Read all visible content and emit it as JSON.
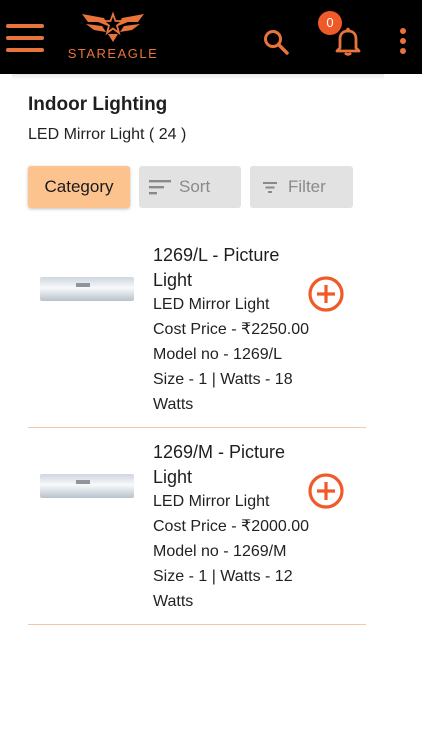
{
  "header": {
    "brand": "STAREAGLE",
    "notification_count": "0",
    "accent_color": "#e8743b",
    "icons": [
      "menu-icon",
      "eagle-logo",
      "search-icon",
      "bell-icon",
      "more-vert-icon"
    ]
  },
  "page": {
    "title": "Indoor Lighting",
    "subtitle": "LED Mirror Light ( 24 )"
  },
  "filters": {
    "category_label": "Category",
    "sort_label": "Sort",
    "filter_label": "Filter"
  },
  "products": [
    {
      "title": "1269/L - Picture Light",
      "category": "LED Mirror Light",
      "cost": "Cost Price - ₹2250.00",
      "model": "Model no - 1269/L",
      "size_watts": "Size - 1 | Watts - 18 Watts"
    },
    {
      "title": "1269/M - Picture Light",
      "category": "LED Mirror Light",
      "cost": "Cost Price - ₹2000.00",
      "model": "Model no - 1269/M",
      "size_watts": "Size - 1 | Watts - 12 Watts"
    }
  ]
}
